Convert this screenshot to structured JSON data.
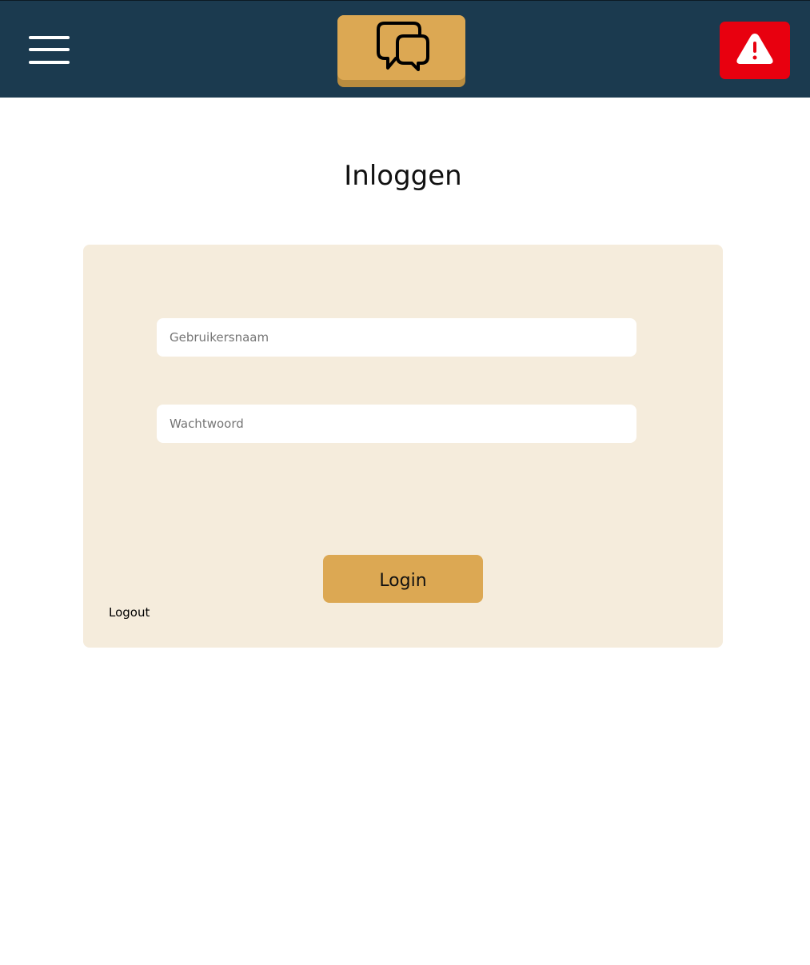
{
  "header": {
    "menu_icon": "hamburger-menu-icon",
    "chat_icon": "chat-bubbles-icon",
    "alert_icon": "warning-triangle-icon"
  },
  "main": {
    "title": "Inloggen"
  },
  "form": {
    "username_placeholder": "Gebruikersnaam",
    "password_placeholder": "Wachtwoord",
    "login_label": "Login",
    "logout_label": "Logout"
  },
  "colors": {
    "header_bg": "#1b3a4f",
    "accent_gold": "#dca853",
    "card_bg": "#f5ecdc",
    "alert_red": "#e8000f"
  }
}
